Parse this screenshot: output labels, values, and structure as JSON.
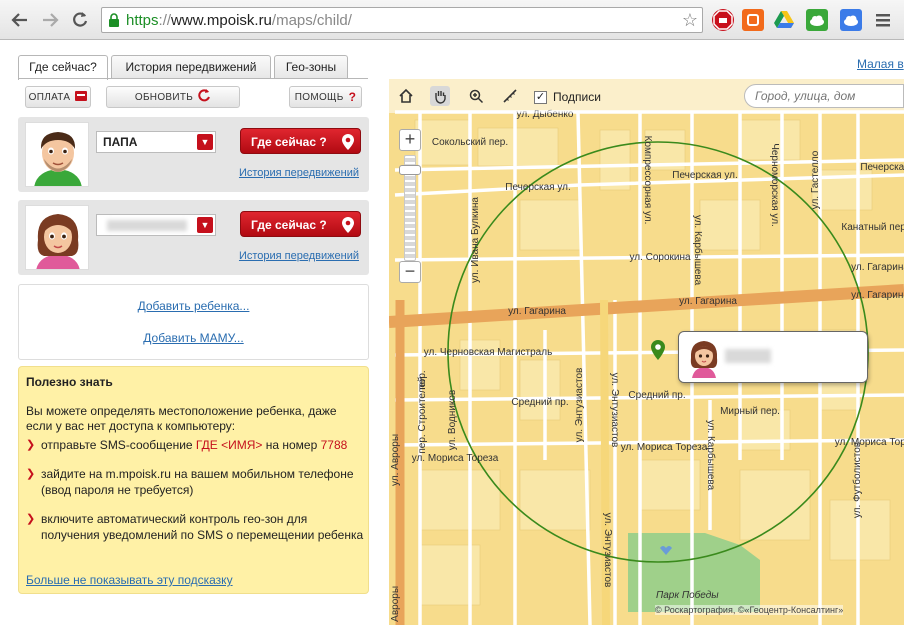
{
  "browser": {
    "url_scheme": "https",
    "url_sep": "://",
    "url_host": "www.mpoisk.ru",
    "url_path": "/maps/child/"
  },
  "tabs": [
    {
      "label": "Где сейчас?",
      "active": true
    },
    {
      "label": "История передвижений",
      "active": false
    },
    {
      "label": "Гео-зоны",
      "active": false
    }
  ],
  "actions": {
    "pay": "ОПЛАТА",
    "refresh": "ОБНОВИТЬ",
    "help": "ПОМОЩЬ"
  },
  "children": [
    {
      "name": "ПАПА",
      "where_label": "Где сейчас ?",
      "history_label": "История передвижений"
    },
    {
      "name": "",
      "where_label": "Где сейчас ?",
      "history_label": "История передвижений"
    }
  ],
  "add": {
    "child": "Добавить ребенка...",
    "mom": "Добавить МАМУ..."
  },
  "tips": {
    "title": "Полезно знать",
    "intro": "Вы можете определять местоположение ребенка, даже если у вас нет доступа к компьютеру:",
    "sms_pre": "отправьте SMS-сообщение ",
    "sms_code": "ГДЕ <ИМЯ>",
    "sms_mid": " на номер ",
    "sms_number": "7788",
    "mobile": "зайдите на m.mpoisk.ru на вашем мобильном телефоне (ввод пароля не требуется)",
    "geo": "включите автоматический контроль гео-зон для получения уведомлений по SMS о перемещении ребенка",
    "hide": "Больше не показывать эту подсказку"
  },
  "small_version_link": "Малая в",
  "map": {
    "labels_checkbox": "Подписи",
    "search_placeholder": "Город, улица, дом",
    "park": "Парк Победы",
    "copyright": "© Роскартография, ©«Геоцентр-Консалтинг»",
    "streets": [
      {
        "name": "ул. Дыбенко"
      },
      {
        "name": "Сокольский пер."
      },
      {
        "name": "Печерская ул."
      },
      {
        "name": "Печерская ул."
      },
      {
        "name": "Печерская"
      },
      {
        "name": "ул. Сорокина"
      },
      {
        "name": "Канатный пер."
      },
      {
        "name": "ул. Гагарина"
      },
      {
        "name": "ул. Гагарина"
      },
      {
        "name": "ул. Гагарина"
      },
      {
        "name": "ул. Гагарина"
      },
      {
        "name": "ул. Черновская Магистраль"
      },
      {
        "name": "Средний пр."
      },
      {
        "name": "Средний пр."
      },
      {
        "name": "Мирный пер."
      },
      {
        "name": "ул. Мориса Тореза"
      },
      {
        "name": "ул. Мориса Тореза"
      },
      {
        "name": "ул. Мориса Тореза"
      },
      {
        "name": "ул. Ивана Булкина"
      },
      {
        "name": "Компрессорная ул."
      },
      {
        "name": "ул. Карбышева"
      },
      {
        "name": "ул. Карбышева"
      },
      {
        "name": "Черноморская ул."
      },
      {
        "name": "ул. Гастелло"
      },
      {
        "name": "ул. Энтузиастов"
      },
      {
        "name": "ул. Энтузиастов"
      },
      {
        "name": "ул. Энтузиастов"
      },
      {
        "name": "ул. Водников"
      },
      {
        "name": "пер. Строителей"
      },
      {
        "name": "ул. Авроры"
      },
      {
        "name": "ул. Авроры"
      },
      {
        "name": "ул. Футболистов"
      },
      {
        "name": "пер."
      }
    ]
  },
  "colors": {
    "accent_red": "#c5101c",
    "link": "#2a6db0",
    "map_bg": "#f7dc8c",
    "main_road": "#e8a45a",
    "geo_circle": "#3a8a1c",
    "tips_bg": "#fff1a6"
  }
}
